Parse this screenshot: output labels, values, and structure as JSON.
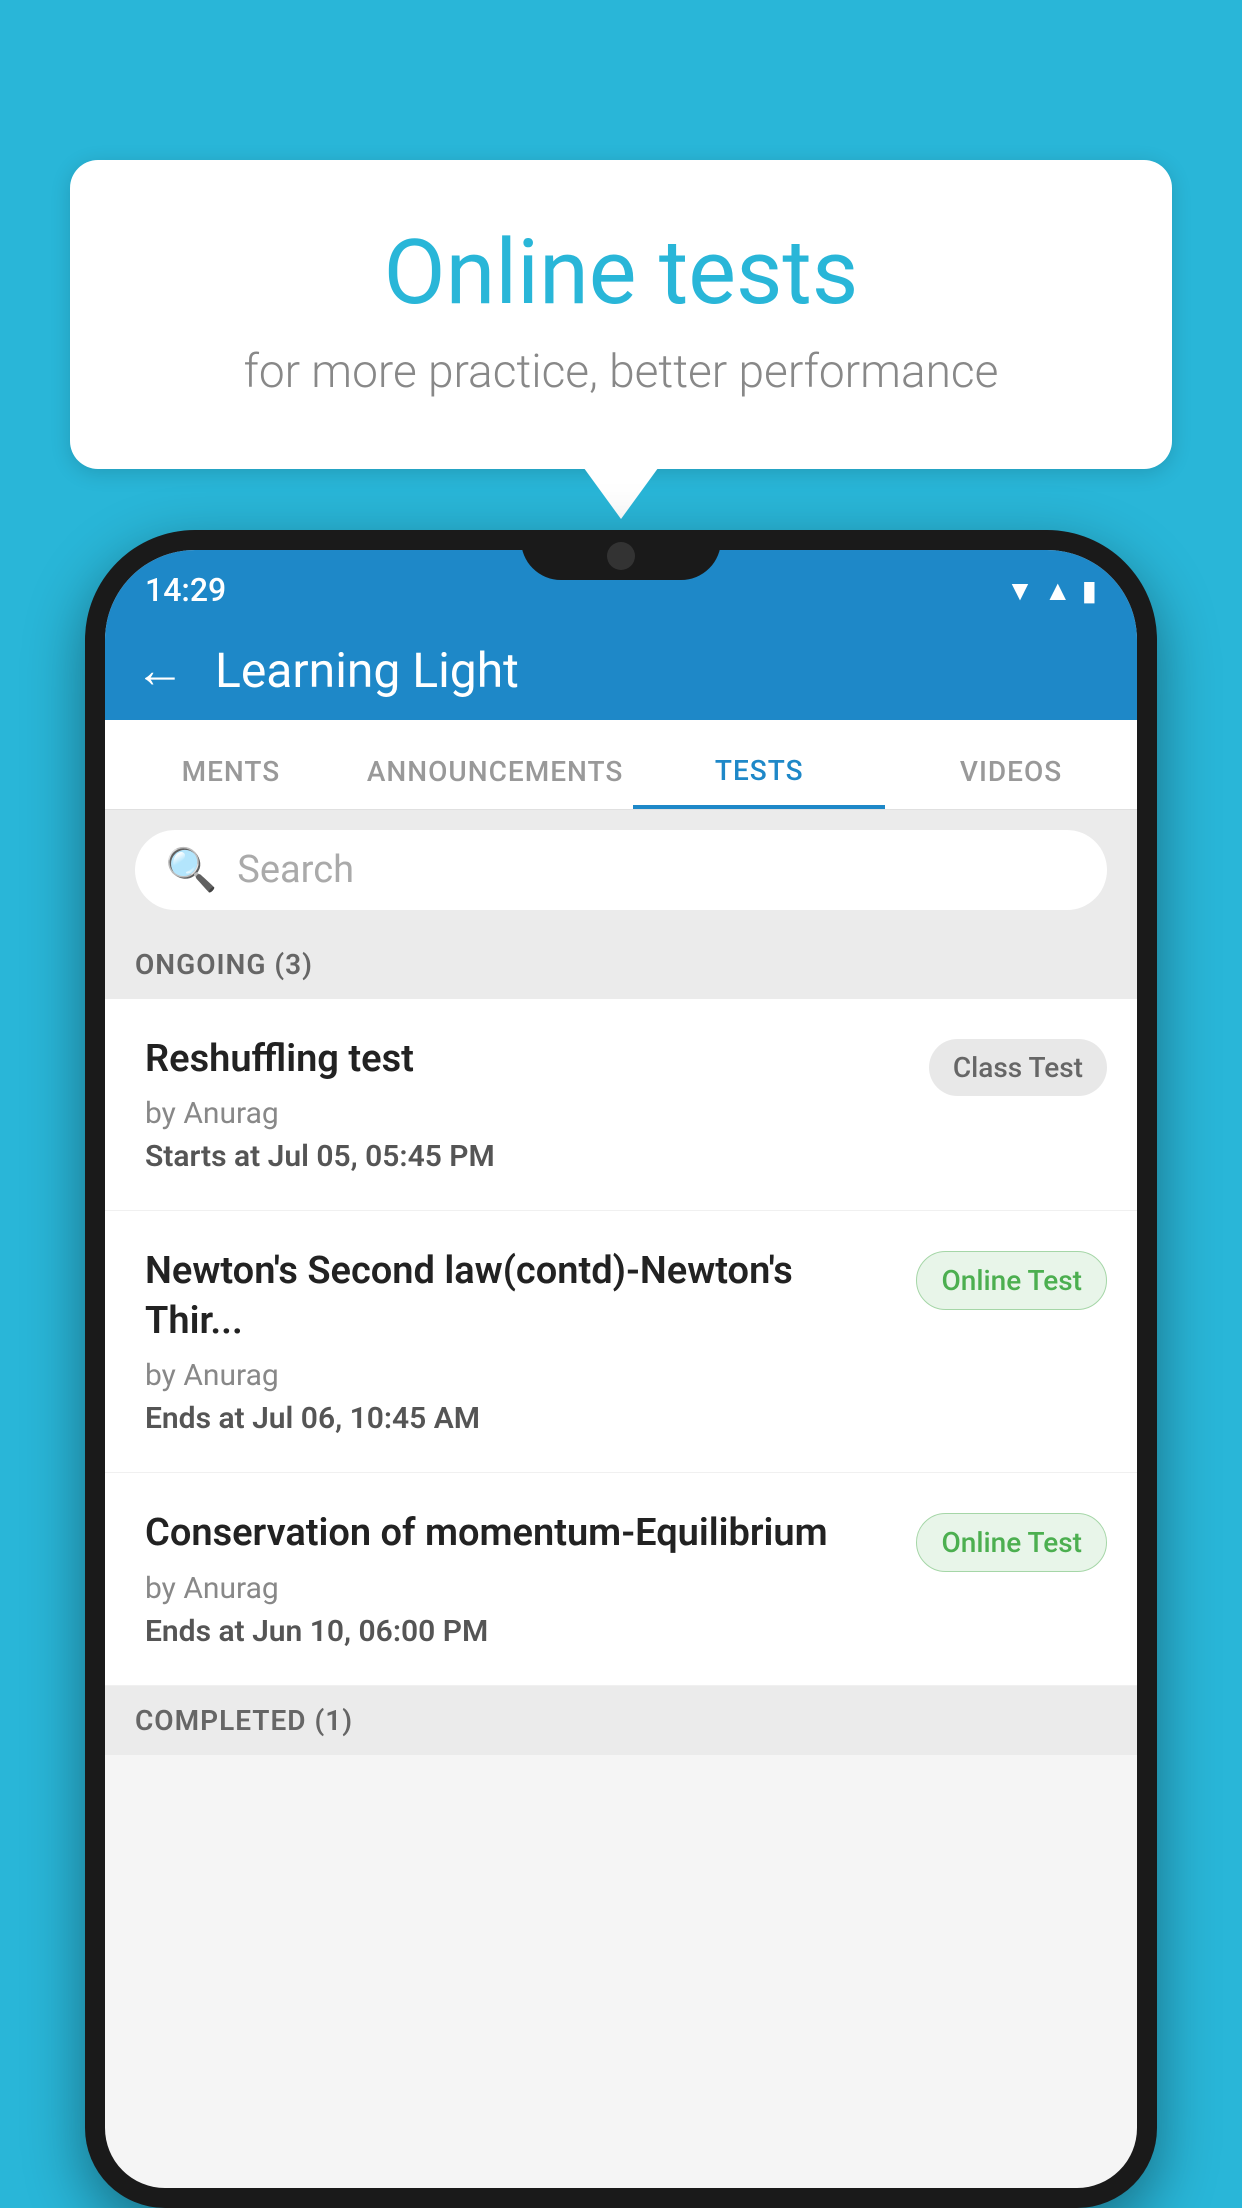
{
  "background_color": "#29b6d8",
  "speech_bubble": {
    "title": "Online tests",
    "subtitle": "for more practice, better performance"
  },
  "phone": {
    "status_bar": {
      "time": "14:29",
      "icons": [
        "wifi",
        "signal",
        "battery"
      ]
    },
    "header": {
      "back_label": "←",
      "title": "Learning Light"
    },
    "tabs": [
      {
        "label": "MENTS",
        "active": false
      },
      {
        "label": "ANNOUNCEMENTS",
        "active": false
      },
      {
        "label": "TESTS",
        "active": true
      },
      {
        "label": "VIDEOS",
        "active": false
      }
    ],
    "search": {
      "placeholder": "Search"
    },
    "sections": [
      {
        "title": "ONGOING (3)",
        "tests": [
          {
            "name": "Reshuffling test",
            "author": "by Anurag",
            "time_label": "Starts at",
            "time_value": "Jul 05, 05:45 PM",
            "badge": "Class Test",
            "badge_type": "class"
          },
          {
            "name": "Newton's Second law(contd)-Newton's Thir...",
            "author": "by Anurag",
            "time_label": "Ends at",
            "time_value": "Jul 06, 10:45 AM",
            "badge": "Online Test",
            "badge_type": "online"
          },
          {
            "name": "Conservation of momentum-Equilibrium",
            "author": "by Anurag",
            "time_label": "Ends at",
            "time_value": "Jun 10, 06:00 PM",
            "badge": "Online Test",
            "badge_type": "online"
          }
        ]
      }
    ],
    "completed_section_label": "COMPLETED (1)"
  }
}
